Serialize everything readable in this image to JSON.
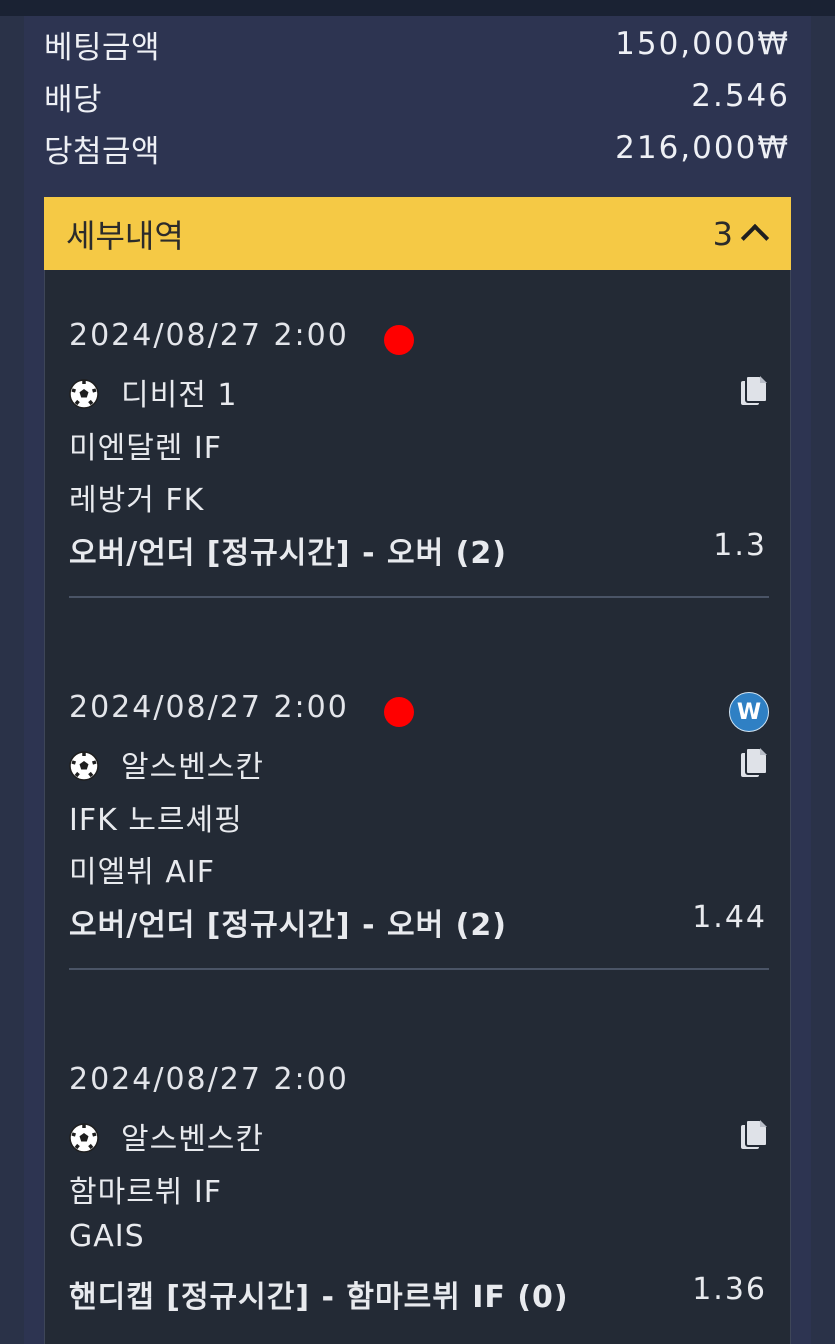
{
  "summary": {
    "bet_label": "베팅금액",
    "bet_value": "150,000₩",
    "odds_label": "배당",
    "odds_value": "2.546",
    "win_label": "당첨금액",
    "win_value": "216,000₩"
  },
  "details": {
    "title": "세부내역",
    "count": "3"
  },
  "bets": [
    {
      "datetime": "2024/08/27 2:00",
      "league": "디비전 1",
      "home": "미엔달렌 IF",
      "away": "레방거 FK",
      "pick": "오버/언더 [정규시간] - 오버 (2)",
      "odds": "1.3",
      "status_dot": true,
      "badge": ""
    },
    {
      "datetime": "2024/08/27 2:00",
      "league": "알스벤스칸",
      "home": "IFK 노르셰핑",
      "away": "미엘뷔 AIF",
      "pick": "오버/언더 [정규시간] - 오버 (2)",
      "odds": "1.44",
      "status_dot": true,
      "badge": "W"
    },
    {
      "datetime": "2024/08/27 2:00",
      "league": "알스벤스칸",
      "home": "함마르뷔 IF",
      "away": "GAIS",
      "pick": "핸디캡 [정규시간] - 함마르뷔 IF (0)",
      "odds": "1.36",
      "status_dot": false,
      "badge": ""
    }
  ],
  "colors": {
    "accent_header": "#f5c945",
    "status_red": "#ff0000",
    "badge_blue": "#2f80c4"
  },
  "icons": [
    "soccer-ball-icon",
    "copy-icon",
    "chevron-up-icon"
  ]
}
